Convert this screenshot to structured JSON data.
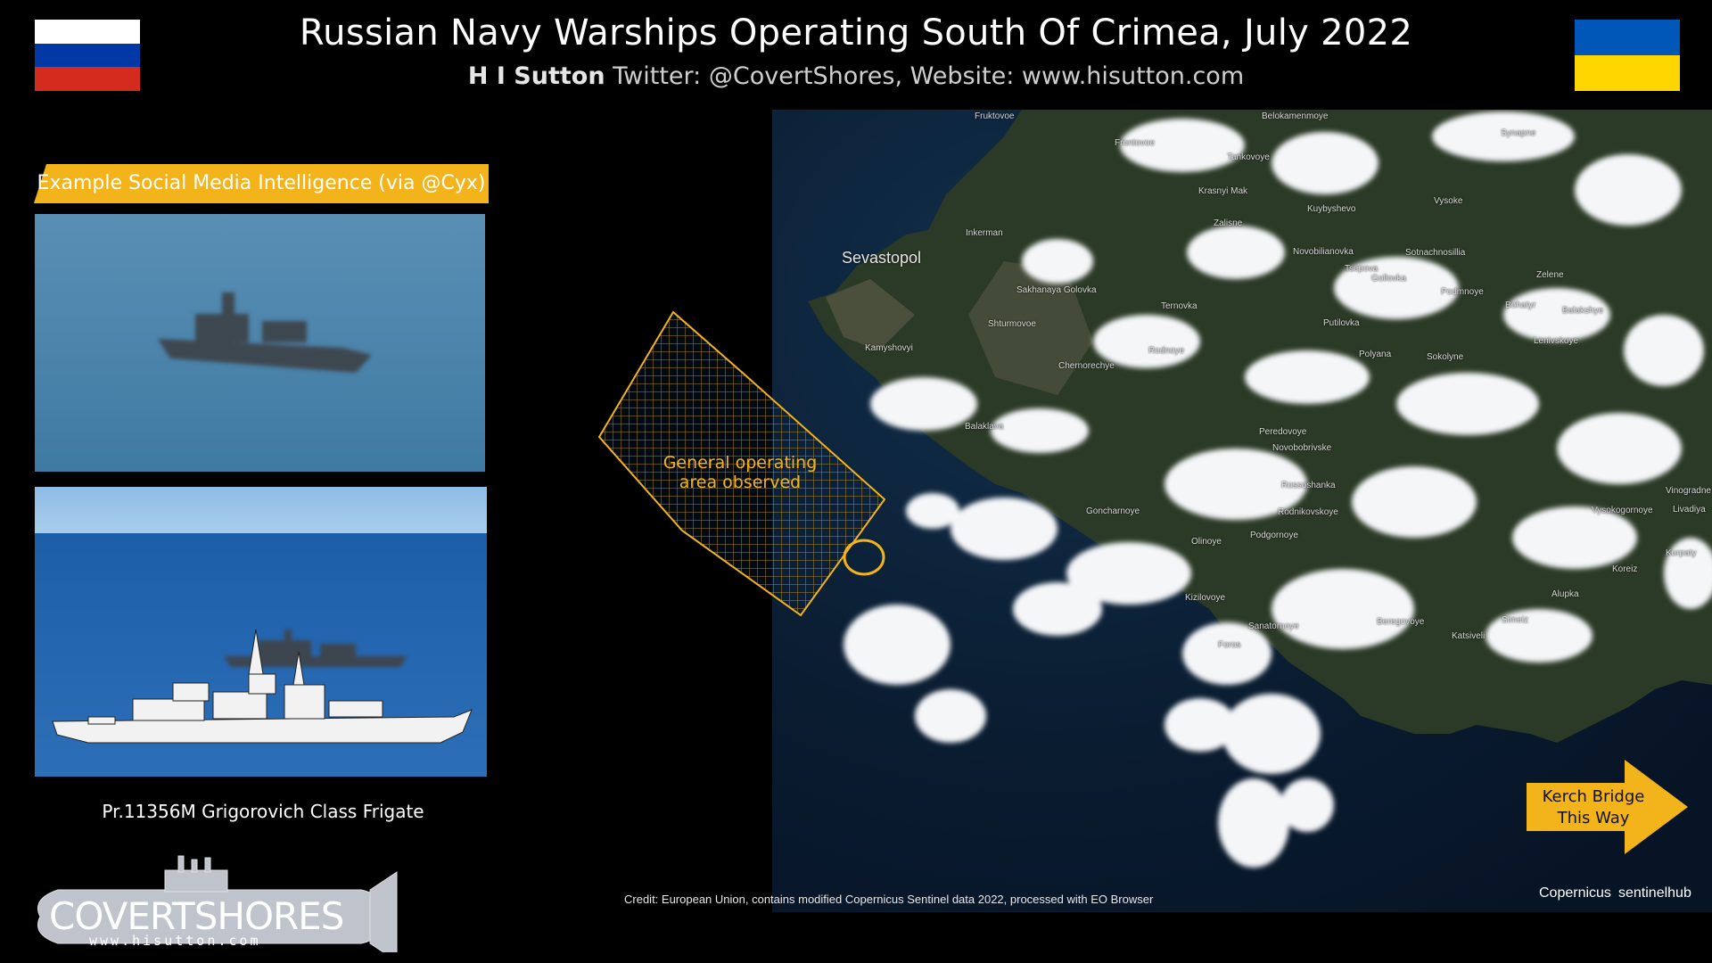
{
  "header": {
    "title": "Russian Navy Warships Operating South Of Crimea, July 2022",
    "author": "H I Sutton",
    "subtitle_rest": "Twitter: @CovertShores, Website: www.hisutton.com"
  },
  "flags": {
    "russia": [
      "#ffffff",
      "#0039a6",
      "#d52b1e"
    ],
    "ukraine": [
      "#0057b7",
      "#ffd700"
    ]
  },
  "sidebar": {
    "banner": "Example Social Media Intelligence (via @Cyx)",
    "banner_color": "#f2b31b",
    "ship_caption": "Pr.11356M  Grigorovich Class Frigate"
  },
  "map": {
    "area_label_line1": "General operating",
    "area_label_line2": "area observed",
    "highlight_color": "#f2b31b",
    "sea_color": "#0b1d33",
    "towns": [
      "Fruktovoe",
      "Belokamenmoye",
      "Synapne",
      "Frontovoe",
      "Tankovoye",
      "Krasnyi Mak",
      "Kuybyshevo",
      "Vysoke",
      "Inkerman",
      "Zalisne",
      "Sevastopol",
      "Novobilianovka",
      "Sotnachnosillia",
      "Zelene",
      "Sakhanaya Golovka",
      "Tsepova",
      "Gollovka",
      "Podmnoye",
      "Bohatyr",
      "Balakshye",
      "Shturmovoe",
      "Ternovka",
      "Putilovka",
      "Rodnoye",
      "Polyana",
      "Sokolyne",
      "Chernorechye",
      "Kamyshovyi",
      "Lenivskoye",
      "Balaklava",
      "Peredovoye",
      "Novobobrivske",
      "Rossoshanka",
      "Vinogradne",
      "Goncharnoye",
      "Rodnikovskoye",
      "Vysokogornoye",
      "Livadiya",
      "Podgornoye",
      "Olinoye",
      "Koreiz",
      "Kurpaty",
      "Kizilovoye",
      "Alupka",
      "Sanatornoye",
      "Beregovoye",
      "Simeiz",
      "Katsiveli",
      "Foros"
    ]
  },
  "kerch_label": {
    "line1": "Kerch Bridge",
    "line2": "This Way"
  },
  "credit": "Credit: European Union, contains modified Copernicus Sentinel data 2022, processed with EO Browser",
  "logos": {
    "copernicus": "Copernicus",
    "sentinelhub": "sentinelhub"
  },
  "covertshores": {
    "name": "COVERTSHORES",
    "url": "www.hisutton.com"
  }
}
